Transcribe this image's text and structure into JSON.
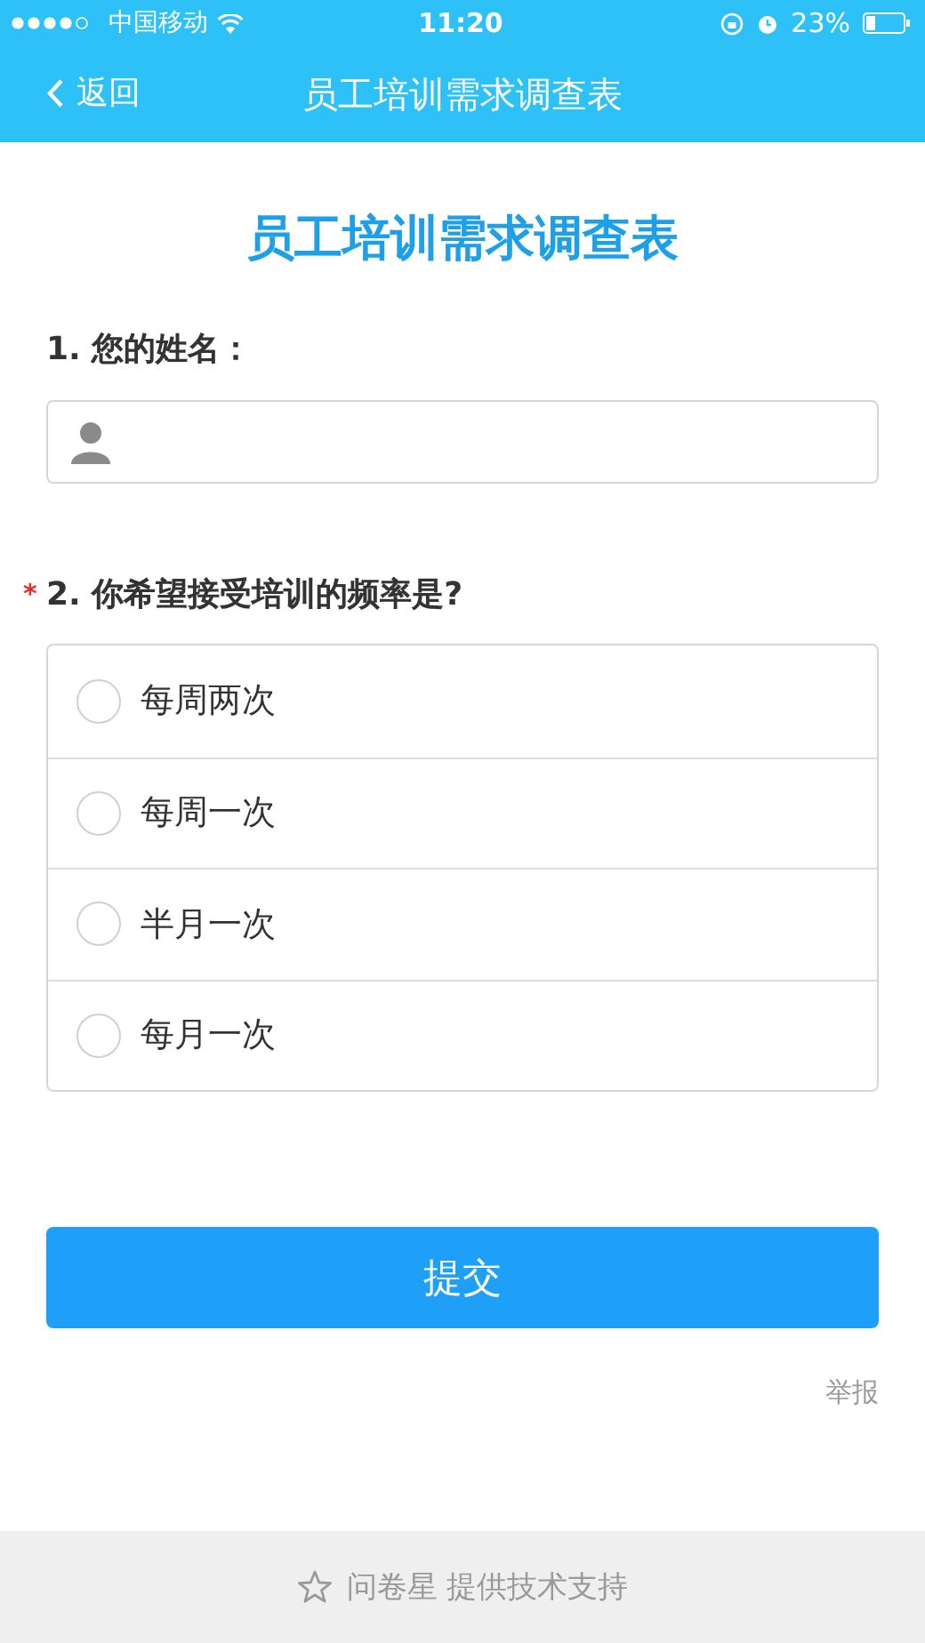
{
  "status_bar": {
    "carrier": "中国移动",
    "time": "11:20",
    "battery": "23%"
  },
  "nav": {
    "back": "返回",
    "title": "员工培训需求调查表"
  },
  "form_title": "员工培训需求调查表",
  "questions": [
    {
      "kind": "text",
      "number": "1.",
      "label": "您的姓名："
    },
    {
      "kind": "radio",
      "number": "2.",
      "label": "你希望接受培训的频率是?",
      "required_mark": "*",
      "options": [
        {
          "label": "每周两次",
          "selected": false
        },
        {
          "label": "每周一次",
          "selected": false
        },
        {
          "label": "半月一次",
          "selected": false
        },
        {
          "label": "每月一次",
          "selected": false
        }
      ]
    }
  ],
  "submit": "提交",
  "report": "举报",
  "footer": "问卷星 提供技术支持"
}
